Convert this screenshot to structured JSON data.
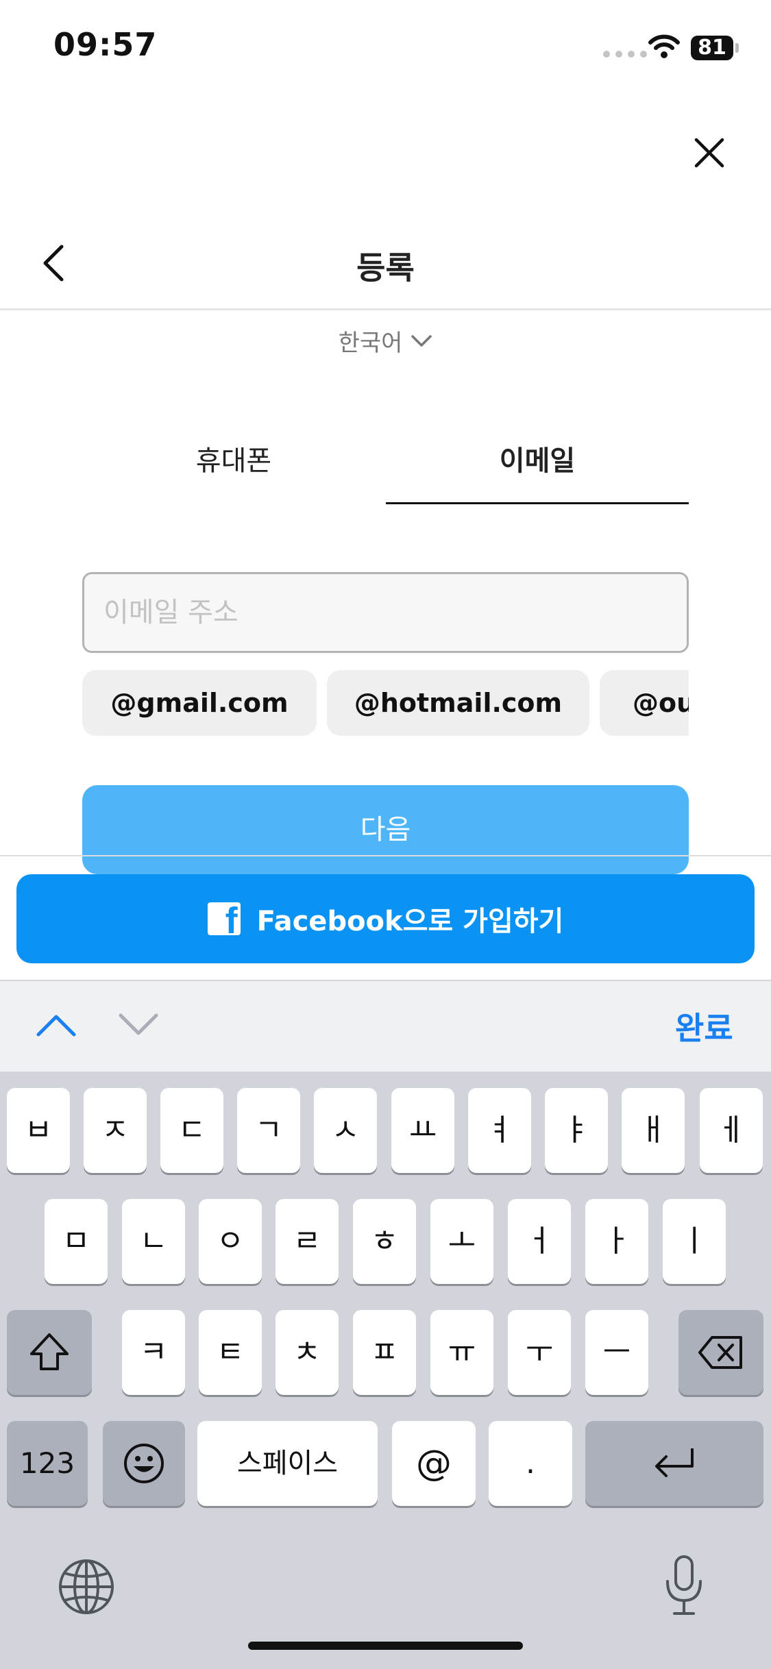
{
  "status_bar": {
    "time": "09:57",
    "battery": "81"
  },
  "header": {
    "title": "등록"
  },
  "language": {
    "label": "한국어"
  },
  "tabs": [
    {
      "label": "휴대폰",
      "selected": false
    },
    {
      "label": "이메일",
      "selected": true
    }
  ],
  "email_field": {
    "placeholder": "이메일 주소",
    "value": ""
  },
  "suggestions": [
    "@gmail.com",
    "@hotmail.com",
    "@ou"
  ],
  "next_button": {
    "label": "다음"
  },
  "facebook_button": {
    "label": "Facebook으로 가입하기"
  },
  "accessory_bar": {
    "done_label": "완료"
  },
  "keyboard": {
    "row1": [
      "ㅂ",
      "ㅈ",
      "ㄷ",
      "ㄱ",
      "ㅅ",
      "ㅛ",
      "ㅕ",
      "ㅑ",
      "ㅐ",
      "ㅔ"
    ],
    "row2": [
      "ㅁ",
      "ㄴ",
      "ㅇ",
      "ㄹ",
      "ㅎ",
      "ㅗ",
      "ㅓ",
      "ㅏ",
      "ㅣ"
    ],
    "row3": [
      "ㅋ",
      "ㅌ",
      "ㅊ",
      "ㅍ",
      "ㅠ",
      "ㅜ",
      "ㅡ"
    ],
    "numbers_key": "123",
    "space_key": "스페이스",
    "at_key": "@",
    "period_key": "."
  },
  "colors": {
    "accent": "#0b93f4",
    "next_button": "#4db5f8",
    "done": "#1a7ff0"
  }
}
